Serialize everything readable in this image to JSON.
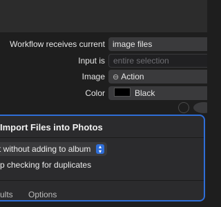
{
  "workflow_header": {
    "receives_label": "Workflow receives current",
    "receives_value": "image files",
    "input_label": "Input is",
    "input_placeholder": "entire selection",
    "image_label": "Image",
    "image_value": "Action",
    "image_icon": "gear-icon",
    "color_label": "Color",
    "color_value": "Black",
    "color_swatch": "#000000"
  },
  "action": {
    "title": "Import Files into Photos",
    "album_option": "rt without adding to album",
    "duplicates_label": "p checking for duplicates",
    "tabs": {
      "results": "sults",
      "options": "Options"
    },
    "accent_color": "#2f6ed8"
  }
}
